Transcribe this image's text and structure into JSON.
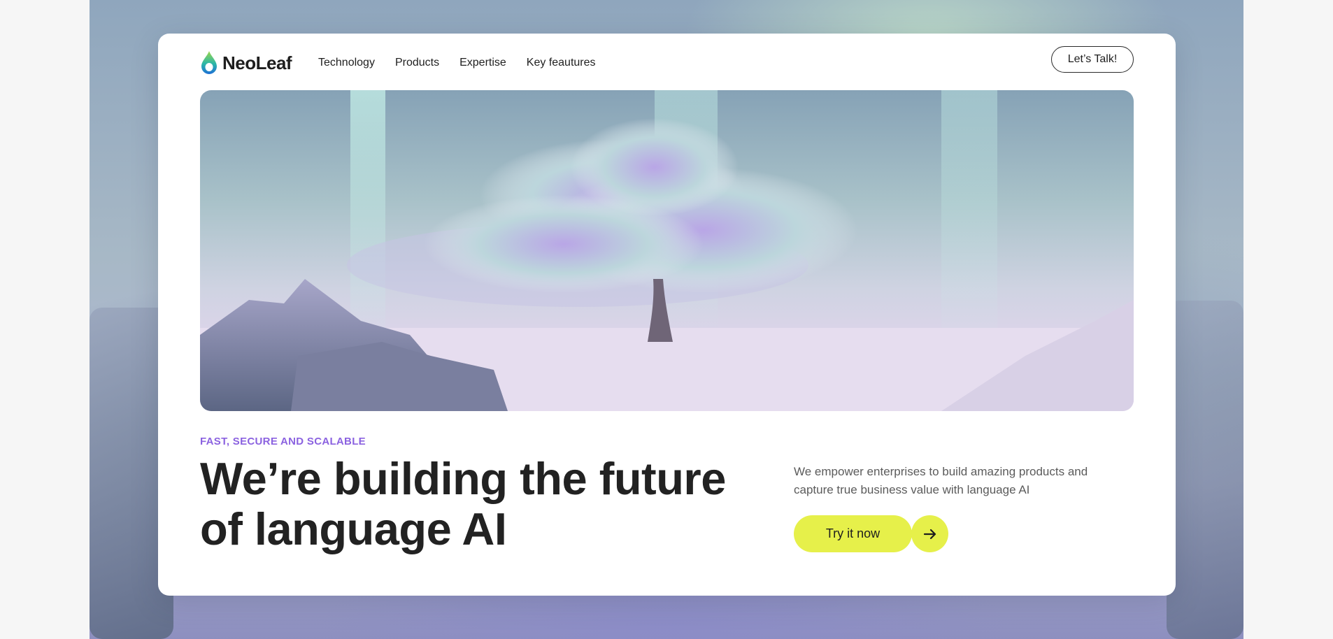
{
  "brand": {
    "name": "NeoLeaf",
    "logo_icon": "droplet-leaf-icon",
    "accent_color": "#e6f04a",
    "eyebrow_color": "#8b62e0"
  },
  "nav": {
    "items": [
      {
        "label": "Technology"
      },
      {
        "label": "Products"
      },
      {
        "label": "Expertise"
      },
      {
        "label": "Key feautures"
      }
    ],
    "cta_label": "Let’s Talk!"
  },
  "hero": {
    "image_alt": "Glowing tree among rocks"
  },
  "content": {
    "eyebrow": "FAST, SECURE AND SCALABLE",
    "headline": "We’re building the future of language AI",
    "description": "We empower enterprises to build amazing products and capture true business value with language AI",
    "cta_label": "Try it now",
    "cta_icon": "arrow-right-icon"
  }
}
